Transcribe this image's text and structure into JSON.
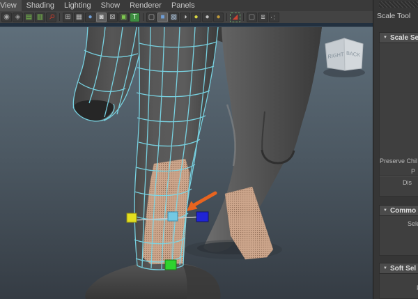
{
  "menubar": {
    "items": [
      {
        "label": "View"
      },
      {
        "label": "Shading"
      },
      {
        "label": "Lighting"
      },
      {
        "label": "Show"
      },
      {
        "label": "Renderer"
      },
      {
        "label": "Panels"
      }
    ]
  },
  "toolbar": {
    "icons": [
      {
        "name": "select-camera-icon",
        "glyph": "◉",
        "color": "#a8a8a8"
      },
      {
        "name": "pan-hand-icon",
        "glyph": "◈",
        "color": "#9a9a9a"
      },
      {
        "name": "bookmark-icon",
        "glyph": "▤",
        "color": "#7ec850"
      },
      {
        "name": "image-plane-icon",
        "glyph": "▥",
        "color": "#7ec850"
      },
      {
        "name": "key-icon",
        "glyph": "⚲",
        "color": "#c0392b",
        "cls": "rot45"
      },
      {
        "sep": true
      },
      {
        "name": "grid-icon",
        "glyph": "⊞",
        "color": "#b5b5b5"
      },
      {
        "name": "film-gate-icon",
        "glyph": "▦",
        "color": "#b5b5b5"
      },
      {
        "name": "resolution-gate-icon",
        "glyph": "●",
        "color": "#6f9fd8"
      },
      {
        "name": "gate-mask-icon",
        "glyph": "◙",
        "color": "#d0d0d0",
        "active": true
      },
      {
        "name": "field-chart-icon",
        "glyph": "⊠",
        "color": "#b5b5b5"
      },
      {
        "name": "safe-action-icon",
        "glyph": "▣",
        "color": "#7ec850"
      },
      {
        "name": "safe-title-icon",
        "glyph": "T",
        "color": "#eaffea",
        "bg": "#3e8e41"
      },
      {
        "sep": true
      },
      {
        "name": "wireframe-cube-icon",
        "glyph": "▢",
        "color": "#b8b8b8"
      },
      {
        "name": "smooth-shade-cube-icon",
        "glyph": "■",
        "color": "#6f9fd8",
        "active": true
      },
      {
        "name": "textured-cube-icon",
        "glyph": "▩",
        "color": "#9fb3c8"
      },
      {
        "name": "checkered-sphere-icon",
        "glyph": "◑",
        "color": "#d0d0d0"
      },
      {
        "name": "light-yellow-sphere-icon",
        "glyph": "●",
        "color": "#d9d943"
      },
      {
        "name": "light-gray-sphere-icon",
        "glyph": "●",
        "color": "#c0c0c0"
      },
      {
        "name": "light-gold-sphere-icon",
        "glyph": "●",
        "color": "#c09a3a"
      },
      {
        "sep": true
      },
      {
        "name": "isolate-select-icon",
        "glyph": "◢",
        "color": "#cc4433",
        "border": "1px dashed #6aa56a"
      },
      {
        "sep": true
      },
      {
        "name": "xray-cube-icon",
        "glyph": "▢",
        "color": "#9a9a9a"
      },
      {
        "name": "frame-cube-icon",
        "glyph": "⧈",
        "color": "#b0b0b0"
      },
      {
        "name": "node-graph-icon",
        "glyph": "∴",
        "color": "#b5b5b5",
        "cls": "rot270"
      }
    ]
  },
  "viewport": {
    "viewcube": {
      "left_face": "RIGHT",
      "right_face": "BACK"
    },
    "wireframe_color": "#7ad8e8",
    "selection_color": "#cda68c",
    "annotation_arrow_color": "#e8641f",
    "manipulator": {
      "x_handle_color": "#e3de1f",
      "z_handle_color": "#2024d6",
      "y_handle_color": "#2fd32f",
      "center_handle_color": "#74c9e3"
    }
  },
  "panel": {
    "title": "Scale Tool",
    "sections": [
      {
        "header": "Scale Se",
        "labels": [
          "Preserve Chil",
          "P",
          "Dis"
        ]
      },
      {
        "header": "Commo",
        "labels": [
          "Sele"
        ]
      },
      {
        "header": "Soft Sel",
        "labels": [
          "F"
        ]
      }
    ]
  }
}
